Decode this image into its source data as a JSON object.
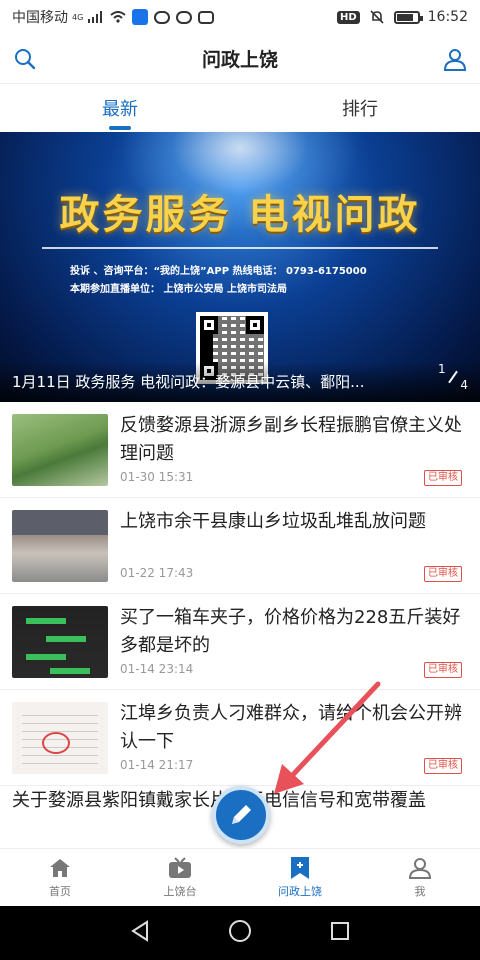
{
  "status_bar": {
    "carrier": "中国移动",
    "network": "4G",
    "hd_label": "HD",
    "time": "16:52",
    "battery_level": 0.85
  },
  "header": {
    "title": "问政上饶",
    "left_icon": "search-icon",
    "right_icon": "user-icon"
  },
  "tabs": [
    {
      "label": "最新",
      "active": true
    },
    {
      "label": "排行",
      "active": false
    }
  ],
  "banner": {
    "main_title": "政务服务 电视问政",
    "info_line1": "投诉 、咨询平台：“我的上饶”APP    热线电话： 0793-6175000",
    "info_line2": "本期参加直播单位：  上饶市公安局   上饶市司法局",
    "caption": "1月11日 政务服务 电视问政：婺源县中云镇、鄱阳...",
    "page_current": "1",
    "page_total": "4"
  },
  "news": [
    {
      "title": "反馈婺源县浙源乡副乡长程振鹏官僚主义处理问题",
      "time": "01-30 15:31",
      "badge": "已审核"
    },
    {
      "title": "上饶市余干县康山乡垃圾乱堆乱放问题",
      "time": "01-22 17:43",
      "badge": "已审核"
    },
    {
      "title": "买了一箱车夹子，价格价格为228五斤装好多都是坏的",
      "time": "01-14 23:14",
      "badge": "已审核"
    },
    {
      "title": "江埠乡负责人刁难群众，请给个机会公开辨认一下",
      "time": "01-14 21:17",
      "badge": "已审核"
    }
  ],
  "news_last_title": "关于婺源县紫阳镇戴家长片区无电信信号和宽带覆盖",
  "bottom_nav": [
    {
      "label": "首页",
      "icon": "home-icon",
      "active": false
    },
    {
      "label": "上饶台",
      "icon": "tv-icon",
      "active": false
    },
    {
      "label": "问政上饶",
      "icon": "bookmark-icon",
      "active": true
    },
    {
      "label": "我",
      "icon": "user-icon",
      "active": false
    }
  ],
  "colors": {
    "accent": "#1a6fc2",
    "badge": "#e0504a",
    "arrow": "#e8515a"
  }
}
